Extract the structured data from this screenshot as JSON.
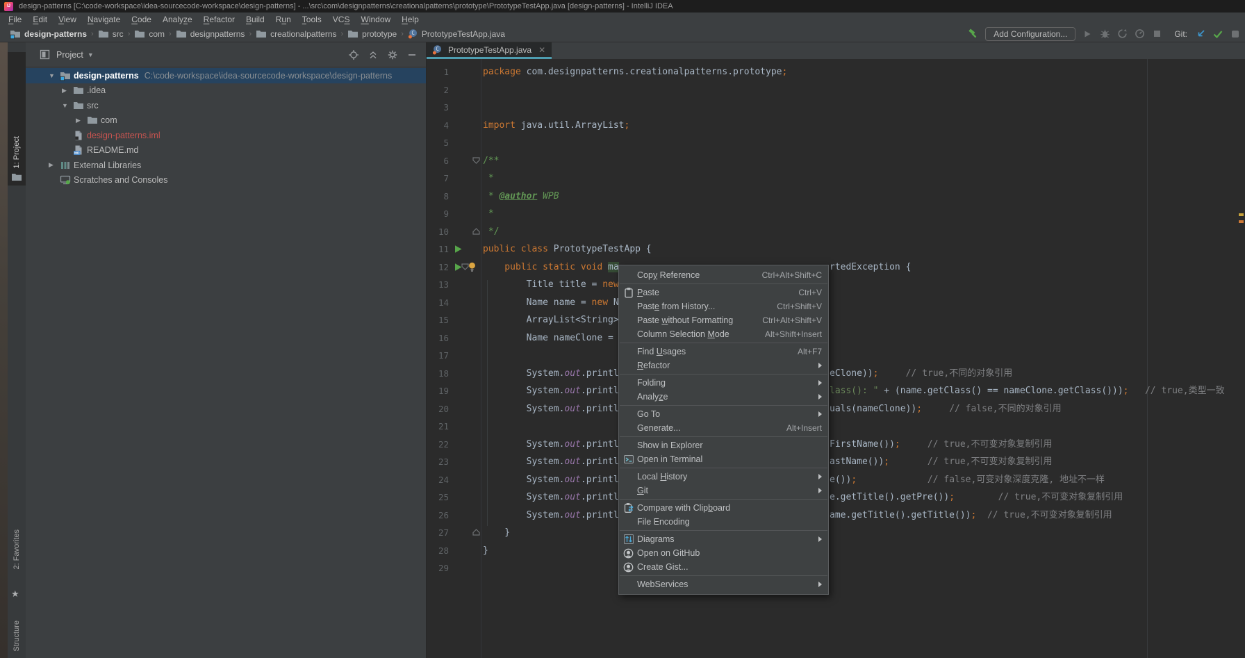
{
  "window": {
    "title": "design-patterns [C:\\code-workspace\\idea-sourcecode-workspace\\design-patterns] - ...\\src\\com\\designpatterns\\creationalpatterns\\prototype\\PrototypeTestApp.java [design-patterns] - IntelliJ IDEA"
  },
  "menu_bar": {
    "items": [
      {
        "label": "File",
        "u": 0
      },
      {
        "label": "Edit",
        "u": 0
      },
      {
        "label": "View",
        "u": 0
      },
      {
        "label": "Navigate",
        "u": 0
      },
      {
        "label": "Code",
        "u": 0
      },
      {
        "label": "Analyze",
        "u": 5
      },
      {
        "label": "Refactor",
        "u": 0
      },
      {
        "label": "Build",
        "u": 0
      },
      {
        "label": "Run",
        "u": 1
      },
      {
        "label": "Tools",
        "u": 0
      },
      {
        "label": "VCS",
        "u": 2
      },
      {
        "label": "Window",
        "u": 0
      },
      {
        "label": "Help",
        "u": 0
      }
    ]
  },
  "toolbar": {
    "breadcrumbs": [
      {
        "label": "design-patterns",
        "icon": "folder-project",
        "bold": true
      },
      {
        "label": "src",
        "icon": "folder"
      },
      {
        "label": "com",
        "icon": "folder"
      },
      {
        "label": "designpatterns",
        "icon": "folder"
      },
      {
        "label": "creationalpatterns",
        "icon": "folder"
      },
      {
        "label": "prototype",
        "icon": "folder"
      },
      {
        "label": "PrototypeTestApp.java",
        "icon": "class"
      }
    ],
    "add_configuration": "Add Configuration...",
    "git_label": "Git:"
  },
  "tool_stripe": {
    "project_tab": "1: Project",
    "favorites_tab": "2: Favorites",
    "structure_tab": "Structure",
    "favorites_icon": "star"
  },
  "project_panel": {
    "header": {
      "title": "Project"
    },
    "tree": [
      {
        "label": "design-patterns",
        "path": "C:\\code-workspace\\idea-sourcecode-workspace\\design-patterns",
        "icon": "folder-project",
        "arrow": "down",
        "indent": 33,
        "selected": true,
        "bold": true
      },
      {
        "label": ".idea",
        "icon": "folder",
        "arrow": "right",
        "indent": 52
      },
      {
        "label": "src",
        "icon": "folder",
        "arrow": "down",
        "indent": 52
      },
      {
        "label": "com",
        "icon": "folder",
        "arrow": "right",
        "indent": 72
      },
      {
        "label": "design-patterns.iml",
        "icon": "iml",
        "indent": 52,
        "color": "red"
      },
      {
        "label": "README.md",
        "icon": "md",
        "indent": 52
      },
      {
        "label": "External Libraries",
        "icon": "lib",
        "arrow": "right",
        "indent": 33
      },
      {
        "label": "Scratches and Consoles",
        "icon": "scratch",
        "indent": 33
      }
    ]
  },
  "editor": {
    "tab": {
      "label": "PrototypeTestApp.java",
      "icon": "class"
    },
    "lines": [
      {
        "n": 1,
        "seg": [
          [
            "k",
            "package"
          ],
          [
            "p",
            " com.designpatterns.creationalpatterns.prototype"
          ],
          [
            "k",
            ";"
          ]
        ]
      },
      {
        "n": 2,
        "seg": []
      },
      {
        "n": 3,
        "seg": []
      },
      {
        "n": 4,
        "seg": [
          [
            "k",
            "import"
          ],
          [
            "p",
            " java.util.ArrayList"
          ],
          [
            "k",
            ";"
          ]
        ]
      },
      {
        "n": 5,
        "seg": []
      },
      {
        "n": 6,
        "seg": [
          [
            "d",
            "/**"
          ]
        ],
        "fold": "start"
      },
      {
        "n": 7,
        "seg": [
          [
            "d",
            " *"
          ]
        ]
      },
      {
        "n": 8,
        "seg": [
          [
            "d",
            " * "
          ],
          [
            "da",
            "@author"
          ],
          [
            "di",
            " WPB"
          ]
        ]
      },
      {
        "n": 9,
        "seg": [
          [
            "d",
            " *"
          ]
        ]
      },
      {
        "n": 10,
        "seg": [
          [
            "d",
            " */"
          ]
        ],
        "fold": "end"
      },
      {
        "n": 11,
        "seg": [
          [
            "k",
            "public class "
          ],
          [
            "p",
            "PrototypeTestApp {"
          ]
        ],
        "run": true
      },
      {
        "n": 12,
        "seg": [
          [
            "k",
            "    public static void "
          ],
          [
            "hl",
            "ma"
          ]
        ],
        "run": true,
        "fold": "start12",
        "bulb": true,
        "right": [
          [
            "p",
            "rtedException {"
          ]
        ]
      },
      {
        "n": 13,
        "seg": [
          [
            "p",
            "        Title title = "
          ],
          [
            "k",
            "new"
          ]
        ]
      },
      {
        "n": 14,
        "seg": [
          [
            "p",
            "        Name name = "
          ],
          [
            "k",
            "new"
          ],
          [
            "p",
            " N"
          ]
        ]
      },
      {
        "n": 15,
        "seg": [
          [
            "p",
            "        ArrayList<String>"
          ]
        ]
      },
      {
        "n": 16,
        "seg": [
          [
            "p",
            "        Name nameClone = "
          ]
        ]
      },
      {
        "n": 17,
        "seg": []
      },
      {
        "n": 18,
        "seg": [
          [
            "p",
            "        System."
          ],
          [
            "o",
            "out"
          ],
          [
            "p",
            ".printl"
          ]
        ],
        "right": [
          [
            "p",
            "eClone))"
          ],
          [
            "k",
            ";"
          ],
          [
            "c",
            "     // true,不同的对象引用"
          ]
        ]
      },
      {
        "n": 19,
        "seg": [
          [
            "p",
            "        System."
          ],
          [
            "o",
            "out"
          ],
          [
            "p",
            ".printl"
          ]
        ],
        "right": [
          [
            "s",
            "lass(): \" "
          ],
          [
            "p",
            "+ (name.getClass() == nameClone.getClass()))"
          ],
          [
            "k",
            ";"
          ],
          [
            "c",
            "   // true,类型一致"
          ]
        ]
      },
      {
        "n": 20,
        "seg": [
          [
            "p",
            "        System."
          ],
          [
            "o",
            "out"
          ],
          [
            "p",
            ".printl"
          ]
        ],
        "right": [
          [
            "p",
            "uals(nameClone))"
          ],
          [
            "k",
            ";"
          ],
          [
            "c",
            "     // false,不同的对象引用"
          ]
        ]
      },
      {
        "n": 21,
        "seg": []
      },
      {
        "n": 22,
        "seg": [
          [
            "p",
            "        System."
          ],
          [
            "o",
            "out"
          ],
          [
            "p",
            ".printl"
          ]
        ],
        "right": [
          [
            "p",
            "FirstName())"
          ],
          [
            "k",
            ";"
          ],
          [
            "c",
            "     // true,不可变对象复制引用"
          ]
        ]
      },
      {
        "n": 23,
        "seg": [
          [
            "p",
            "        System."
          ],
          [
            "o",
            "out"
          ],
          [
            "p",
            ".printl"
          ]
        ],
        "right": [
          [
            "p",
            "astName())"
          ],
          [
            "k",
            ";"
          ],
          [
            "c",
            "       // true,不可变对象复制引用"
          ]
        ]
      },
      {
        "n": 24,
        "seg": [
          [
            "p",
            "        System."
          ],
          [
            "o",
            "out"
          ],
          [
            "p",
            ".printl"
          ]
        ],
        "right": [
          [
            "p",
            "e())"
          ],
          [
            "k",
            ";"
          ],
          [
            "c",
            "             // false,可变对象深度克隆, 地址不一样"
          ]
        ]
      },
      {
        "n": 25,
        "seg": [
          [
            "p",
            "        System."
          ],
          [
            "o",
            "out"
          ],
          [
            "p",
            ".printl"
          ]
        ],
        "right": [
          [
            "p",
            "e.getTitle().getPre())"
          ],
          [
            "k",
            ";"
          ],
          [
            "c",
            "        // true,不可变对象复制引用"
          ]
        ]
      },
      {
        "n": 26,
        "seg": [
          [
            "p",
            "        System."
          ],
          [
            "o",
            "out"
          ],
          [
            "p",
            ".printl"
          ]
        ],
        "right": [
          [
            "p",
            "ame.getTitle().getTitle())"
          ],
          [
            "k",
            ";"
          ],
          [
            "c",
            "  // true,不可变对象复制引用"
          ]
        ]
      },
      {
        "n": 27,
        "seg": [
          [
            "p",
            "    }"
          ]
        ],
        "fold": "end"
      },
      {
        "n": 28,
        "seg": [
          [
            "p",
            "}"
          ]
        ]
      },
      {
        "n": 29,
        "seg": []
      }
    ]
  },
  "context_menu": {
    "items": [
      {
        "label": "Copy Reference",
        "u": 3,
        "shortcut": "Ctrl+Alt+Shift+C"
      },
      {
        "label": "Paste",
        "u": 0,
        "shortcut": "Ctrl+V",
        "icon": "paste",
        "sep": true
      },
      {
        "label": "Paste from History...",
        "u": 4,
        "shortcut": "Ctrl+Shift+V"
      },
      {
        "label": "Paste without Formatting",
        "u": 6,
        "shortcut": "Ctrl+Alt+Shift+V"
      },
      {
        "label": "Column Selection Mode",
        "u": 17,
        "shortcut": "Alt+Shift+Insert"
      },
      {
        "label": "Find Usages",
        "u": 5,
        "shortcut": "Alt+F7",
        "sep": true
      },
      {
        "label": "Refactor",
        "u": 0,
        "submenu": true
      },
      {
        "label": "Folding",
        "submenu": true,
        "sep": true
      },
      {
        "label": "Analyze",
        "u": 5,
        "submenu": true
      },
      {
        "label": "Go To",
        "submenu": true,
        "sep": true
      },
      {
        "label": "Generate...",
        "shortcut": "Alt+Insert"
      },
      {
        "label": "Show in Explorer",
        "sep": true
      },
      {
        "label": "Open in Terminal",
        "icon": "terminal"
      },
      {
        "label": "Local History",
        "u": 6,
        "submenu": true,
        "sep": true
      },
      {
        "label": "Git",
        "u": 0,
        "submenu": true
      },
      {
        "label": "Compare with Clipboard",
        "u": 17,
        "icon": "compare",
        "sep": true
      },
      {
        "label": "File Encoding"
      },
      {
        "label": "Diagrams",
        "icon": "diagrams",
        "submenu": true,
        "sep": true
      },
      {
        "label": "Open on GitHub",
        "icon": "github"
      },
      {
        "label": "Create Gist...",
        "icon": "github"
      },
      {
        "label": "WebServices",
        "submenu": true,
        "sep": true
      }
    ]
  },
  "colors": {
    "tab_underline": "#4e9db0",
    "tree_selection": "#26435f",
    "keyword": "#cc7832",
    "string": "#6a8759",
    "comment": "#7f8083",
    "doc_comment": "#629755",
    "field": "#9876aa",
    "run_green": "#57a64a",
    "error_mark_1": "#c7a23c",
    "error_mark_2": "#cf7a37"
  }
}
